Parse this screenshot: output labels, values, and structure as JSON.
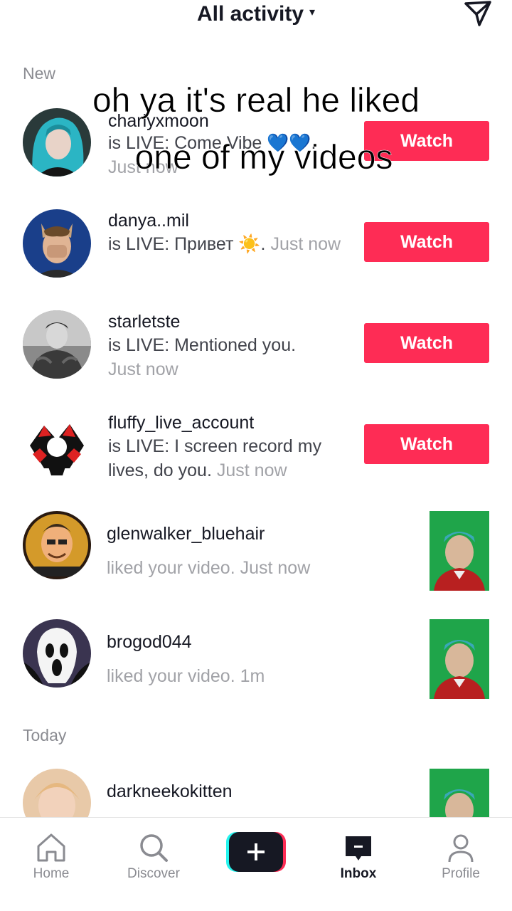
{
  "header": {
    "title": "All activity",
    "caret": "▾",
    "send_icon": "send-icon"
  },
  "sections": {
    "new": "New",
    "today": "Today"
  },
  "overlay": {
    "line1": "oh ya it's real he liked",
    "line2": "one of my videos"
  },
  "live_items": [
    {
      "username": "charlyxmoon",
      "text": "is LIVE: Come Vibe 💙💙.",
      "time": "Just now",
      "button": "Watch"
    },
    {
      "username": "danya..mil",
      "text": "is LIVE: Привет ☀️.",
      "time": "Just now",
      "button": "Watch"
    },
    {
      "username": "starletste",
      "text": "is LIVE: Mentioned you.",
      "time": "Just now",
      "button": "Watch"
    },
    {
      "username": "fluffy_live_account",
      "text": "is LIVE: I screen record my lives, do you.",
      "time": "Just now",
      "button": "Watch"
    }
  ],
  "like_items": [
    {
      "username": "glenwalker_bluehair",
      "text": "liked your video.",
      "time": "Just now"
    },
    {
      "username": "brogod044",
      "text": "liked your video.",
      "time": "1m"
    },
    {
      "username": "darkneekokitten",
      "text": "",
      "time": ""
    }
  ],
  "nav": {
    "home": "Home",
    "discover": "Discover",
    "create_icon": "plus-icon",
    "inbox": "Inbox",
    "profile": "Profile"
  },
  "colors": {
    "accent": "#fe2c55",
    "text": "#161823",
    "muted": "#a1a2a7"
  }
}
